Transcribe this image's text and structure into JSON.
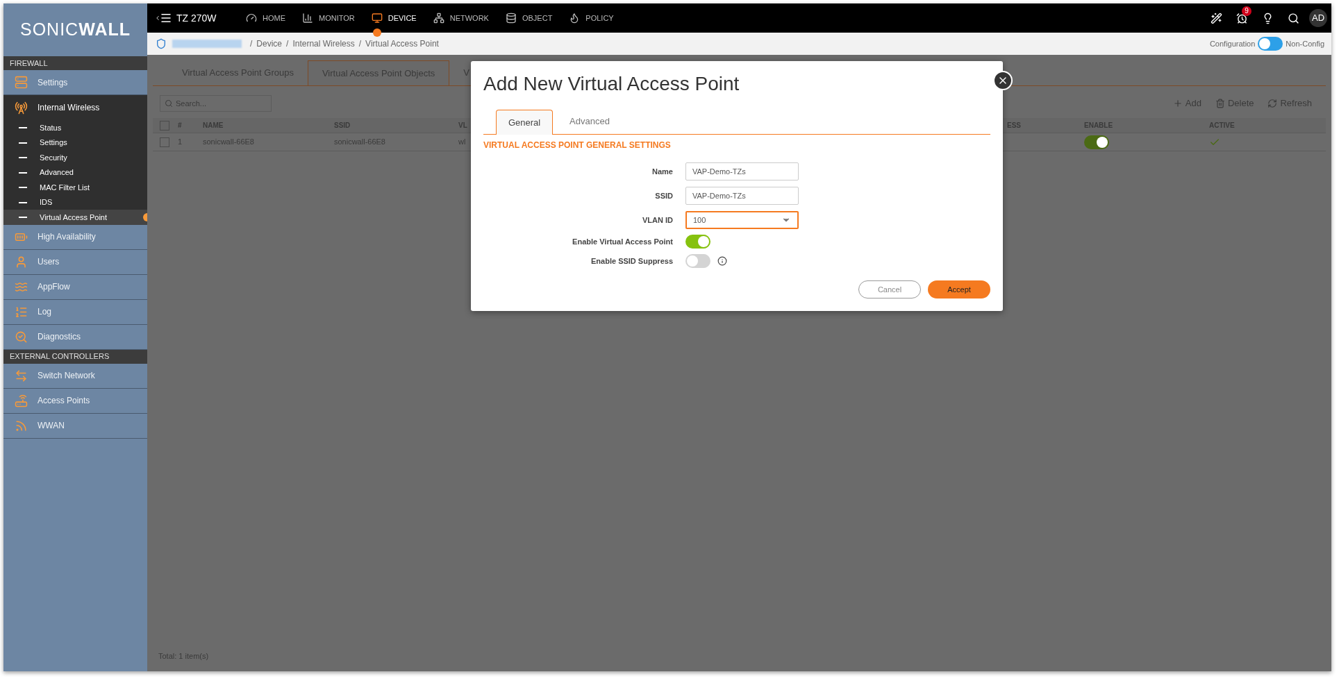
{
  "sidebar": {
    "logo": "SONIC**WALL**",
    "sections": [
      {
        "title": "FIREWALL",
        "items": [
          {
            "label": "Settings",
            "expanded": false
          },
          {
            "label": "Internal Wireless",
            "expanded": true,
            "children": [
              {
                "label": "Status",
                "selected": false
              },
              {
                "label": "Settings",
                "selected": false
              },
              {
                "label": "Security",
                "selected": false
              },
              {
                "label": "Advanced",
                "selected": false
              },
              {
                "label": "MAC Filter List",
                "selected": false
              },
              {
                "label": "IDS",
                "selected": false
              },
              {
                "label": "Virtual Access Point",
                "selected": true
              }
            ]
          },
          {
            "label": "High Availability",
            "expanded": false
          },
          {
            "label": "Users",
            "expanded": false
          },
          {
            "label": "AppFlow",
            "expanded": false
          },
          {
            "label": "Log",
            "expanded": false
          },
          {
            "label": "Diagnostics",
            "expanded": false
          }
        ]
      },
      {
        "title": "EXTERNAL CONTROLLERS",
        "items": [
          {
            "label": "Switch Network",
            "expanded": false
          },
          {
            "label": "Access Points",
            "expanded": false
          },
          {
            "label": "WWAN",
            "expanded": false
          }
        ]
      }
    ]
  },
  "topbar": {
    "device": "TZ 270W",
    "nav": [
      {
        "label": "HOME",
        "selected": false
      },
      {
        "label": "MONITOR",
        "selected": false
      },
      {
        "label": "DEVICE",
        "selected": true
      },
      {
        "label": "NETWORK",
        "selected": false
      },
      {
        "label": "OBJECT",
        "selected": false
      },
      {
        "label": "POLICY",
        "selected": false
      }
    ],
    "notification_count": "9",
    "avatar": "AD"
  },
  "breadcrumb": {
    "items": [
      {
        "separator": "/",
        "label": "Device"
      },
      {
        "separator": "/",
        "label": "Internal Wireless"
      },
      {
        "separator": "/",
        "label": "Virtual Access Point"
      }
    ],
    "mode_switch": {
      "left_label": "Configuration",
      "right_label": "Non-Config",
      "on": false
    }
  },
  "page": {
    "tabs": [
      {
        "label": "Virtual Access Point Groups",
        "selected": false
      },
      {
        "label": "Virtual Access Point Objects",
        "selected": true
      },
      {
        "label": "V",
        "selected": false
      }
    ],
    "search": {
      "placeholder": "Search..."
    },
    "actions": [
      "Add",
      "Delete",
      "Refresh"
    ],
    "table": {
      "columns": [
        "#",
        "NAME",
        "SSID",
        "VL",
        "ESS",
        "ENABLE",
        "ACTIVE"
      ],
      "rows": [
        {
          "checked": false,
          "cells": [
            "1",
            "sonicwall-66E8",
            "sonicwall-66E8",
            "wl"
          ],
          "enabled": true,
          "active": true
        }
      ]
    },
    "header_checked": false,
    "footer": "Total: 1 item(s)"
  },
  "dialog": {
    "title": "Add New Virtual Access Point",
    "tabs": [
      {
        "label": "General",
        "selected": true
      },
      {
        "label": "Advanced",
        "selected": false
      }
    ],
    "section": "VIRTUAL ACCESS POINT GENERAL SETTINGS",
    "fields": [
      {
        "kind": "text",
        "label": "Name",
        "value": "VAP-Demo-TZs",
        "focused": false
      },
      {
        "kind": "text",
        "label": "SSID",
        "value": "VAP-Demo-TZs",
        "focused": false
      },
      {
        "kind": "select",
        "label": "VLAN ID",
        "value": "100",
        "focused": true
      }
    ],
    "toggles": [
      {
        "label": "Enable Virtual Access Point",
        "on": true
      },
      {
        "label": "Enable SSID Suppress",
        "on": false,
        "info": true
      }
    ],
    "buttons": [
      {
        "label": "Cancel",
        "kind": "secondary"
      },
      {
        "label": "Accept",
        "kind": "primary"
      }
    ]
  }
}
